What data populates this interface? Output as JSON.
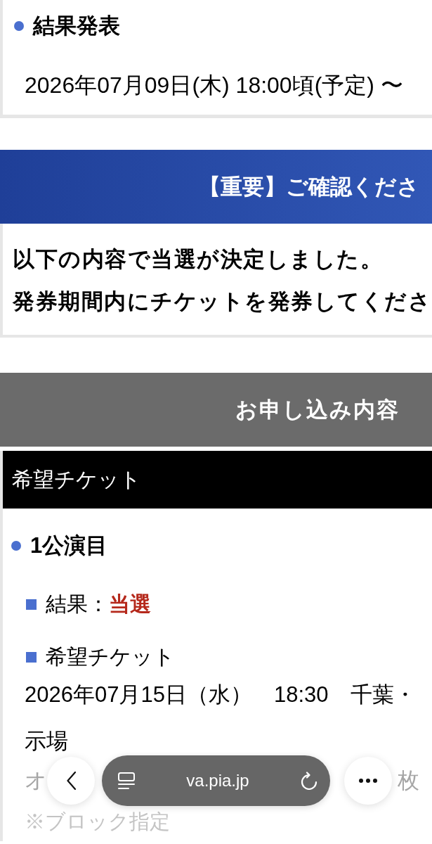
{
  "result_announcement": {
    "heading": "結果発表",
    "datetime": "2026年07月09日(木) 18:00頃(予定) 〜"
  },
  "notice_banner": {
    "title": "【重要】ご確認くださ"
  },
  "notice": {
    "lines": [
      "以下の内容で当選が決定しました。",
      "発券期間内にチケットを発券してくださ"
    ]
  },
  "application_header": {
    "title": "お申し込み内容"
  },
  "ticket_section": {
    "title": "希望チケット",
    "performances": [
      {
        "heading": "1公演目",
        "fields": [
          {
            "kind": "result",
            "label": "結果：",
            "value": "当選"
          },
          {
            "kind": "detail",
            "label": "希望チケット",
            "lines": [
              "2026年07月15日（水）　18:30　千葉・",
              "示場"
            ],
            "covered_line": {
              "start": "オ",
              "end": "枚"
            },
            "note": "※ブロック指定"
          }
        ]
      }
    ]
  },
  "browser_bar": {
    "url": "va.pia.jp"
  }
}
